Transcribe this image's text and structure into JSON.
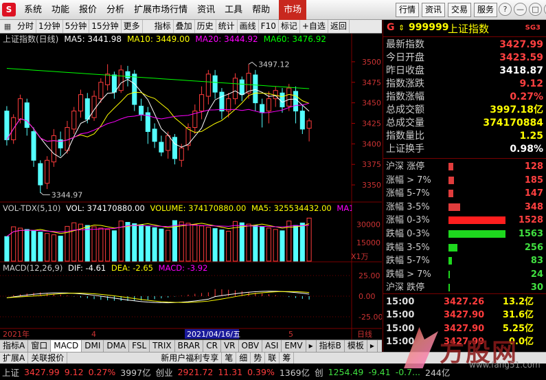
{
  "menu": {
    "logo": "S",
    "items": [
      "系统",
      "功能",
      "报价",
      "分析",
      "扩展市场行情",
      "资讯",
      "工具",
      "帮助"
    ],
    "active": "市场",
    "right": [
      "行情",
      "资讯",
      "交易",
      "服务"
    ]
  },
  "window_controls": [
    "?",
    "—",
    "□",
    "✕"
  ],
  "toolbar": {
    "left": [
      "分时",
      "1分钟",
      "5分钟",
      "15分钟",
      "更多"
    ],
    "right": [
      "指标",
      "叠加",
      "历史",
      "统计",
      "画线",
      "F10",
      "标记",
      "+自选",
      "返回"
    ]
  },
  "chart_title": {
    "name": "上证指数(日线)",
    "ma5": "MA5: 3441.98",
    "ma10": "MA10: 3449.00",
    "ma20": "MA20: 3444.92",
    "ma60": "MA60: 3476.92"
  },
  "price_axis": [
    "3500",
    "3475",
    "3450",
    "3425",
    "3400",
    "3375",
    "3350"
  ],
  "annotations": {
    "high": "3497.12",
    "low": "3344.97"
  },
  "volume": {
    "title": "VOL-TDX(5,10)",
    "vol": "VOL: 374170880.00",
    "volume": "VOLUME: 374170880.00",
    "ma5": "MA5: 325534432.00",
    "ma10": "MA1",
    "axis": [
      "30000",
      "15000"
    ],
    "unit": "X1万"
  },
  "macd": {
    "title": "MACD(12,26,9)",
    "dif": "DIF: -4.61",
    "dea": "DEA: -2.65",
    "macd": "MACD: -3.92",
    "axis": [
      "25.00",
      "0.00",
      "-25.00"
    ]
  },
  "date_axis": {
    "left": "2021年",
    "m4": "4",
    "current": "2021/04/16/五",
    "m5": "5",
    "right_label": "日线"
  },
  "bottom_tabs": [
    "指标A",
    "窗口",
    "MACD",
    "DMI",
    "DMA",
    "FSL",
    "TRIX",
    "BRAR",
    "CR",
    "VR",
    "OBV",
    "ASI",
    "EMV",
    "▸",
    "指标B",
    "模板",
    "▸"
  ],
  "bottom_tabs2": [
    "扩展A",
    "关联报价",
    "新用户福利专享",
    "笔",
    "细",
    "势",
    "联",
    "筹"
  ],
  "quote": {
    "g": "G",
    "code": "999999",
    "name": "上证指数",
    "badge": "SG3",
    "rows": [
      {
        "label": "最新指数",
        "value": "3427.99",
        "color": "#ff4040"
      },
      {
        "label": "今日开盘",
        "value": "3423.59",
        "color": "#ff4040"
      },
      {
        "label": "昨日收盘",
        "value": "3418.87",
        "color": "#ffffff"
      },
      {
        "label": "指数涨跌",
        "value": "9.12",
        "color": "#ff4040"
      },
      {
        "label": "指数涨幅",
        "value": "0.27%",
        "color": "#ff4040"
      },
      {
        "label": "总成交额",
        "value": "3997.18亿",
        "color": "#ffff00"
      },
      {
        "label": "总成交量",
        "value": "374170884",
        "color": "#ffff00"
      },
      {
        "label": "指数量比",
        "value": "1.25",
        "color": "#ffff00"
      },
      {
        "label": "上证换手",
        "value": "0.98%",
        "color": "#ffffff"
      }
    ]
  },
  "breadth": [
    {
      "label": "沪深 涨停",
      "count": "128",
      "pct": 8,
      "color": "#e03c3c",
      "tcolor": "#ff4040"
    },
    {
      "label": "涨幅 > 7%",
      "count": "185",
      "pct": 10,
      "color": "#e03c3c",
      "tcolor": "#ff4040"
    },
    {
      "label": "涨幅 5-7%",
      "count": "147",
      "pct": 8,
      "color": "#e03c3c",
      "tcolor": "#ff4040"
    },
    {
      "label": "涨幅 3-5%",
      "count": "348",
      "pct": 21,
      "color": "#e03c3c",
      "tcolor": "#ff4040"
    },
    {
      "label": "涨幅 0-3%",
      "count": "1528",
      "pct": 100,
      "color": "#ff1e1e",
      "tcolor": "#ff4040"
    },
    {
      "label": "跌幅 0-3%",
      "count": "1563",
      "pct": 100,
      "color": "#1ed81e",
      "tcolor": "#40e040"
    },
    {
      "label": "跌幅 3-5%",
      "count": "256",
      "pct": 16,
      "color": "#1ed81e",
      "tcolor": "#40e040"
    },
    {
      "label": "跌幅 5-7%",
      "count": "83",
      "pct": 6,
      "color": "#1ed81e",
      "tcolor": "#40e040"
    },
    {
      "label": "跌幅 > 7%",
      "count": "24",
      "pct": 2,
      "color": "#1ed81e",
      "tcolor": "#40e040"
    },
    {
      "label": "沪深 跌停",
      "count": "30",
      "pct": 2,
      "color": "#1ed81e",
      "tcolor": "#40e040"
    }
  ],
  "ticks": [
    {
      "time": "15:00",
      "price": "3427.26",
      "vol": "13.2亿"
    },
    {
      "time": "15:00",
      "price": "3427.90",
      "vol": "31.6亿"
    },
    {
      "time": "15:00",
      "price": "3427.90",
      "vol": "5.25亿"
    },
    {
      "time": "15:00",
      "price": "3427.99",
      "vol": "0.0亿"
    }
  ],
  "status": {
    "sh_label": "上证",
    "sh_price": "3427.99",
    "sh_chg": "9.12",
    "sh_pct": "0.27%",
    "sh_amt": "3997亿",
    "cy_label": "创业",
    "cy_price": "2921.72",
    "cy_chg": "11.31",
    "cy_pct": "0.39%",
    "cy_amt": "1369亿",
    "x_label": "创",
    "x_price": "1254.49",
    "x_chg": "-9.41",
    "x_pct": "-0.7...",
    "x_amt": "244亿"
  },
  "watermark": {
    "brand": "方股网",
    "url": "www.fang51.com"
  },
  "colors": {
    "up": "#ff3c3c",
    "down": "#54ffff",
    "ma5": "#ffffff",
    "ma10": "#ffff00",
    "ma20": "#ff00ff",
    "ma60": "#00ff00"
  }
}
